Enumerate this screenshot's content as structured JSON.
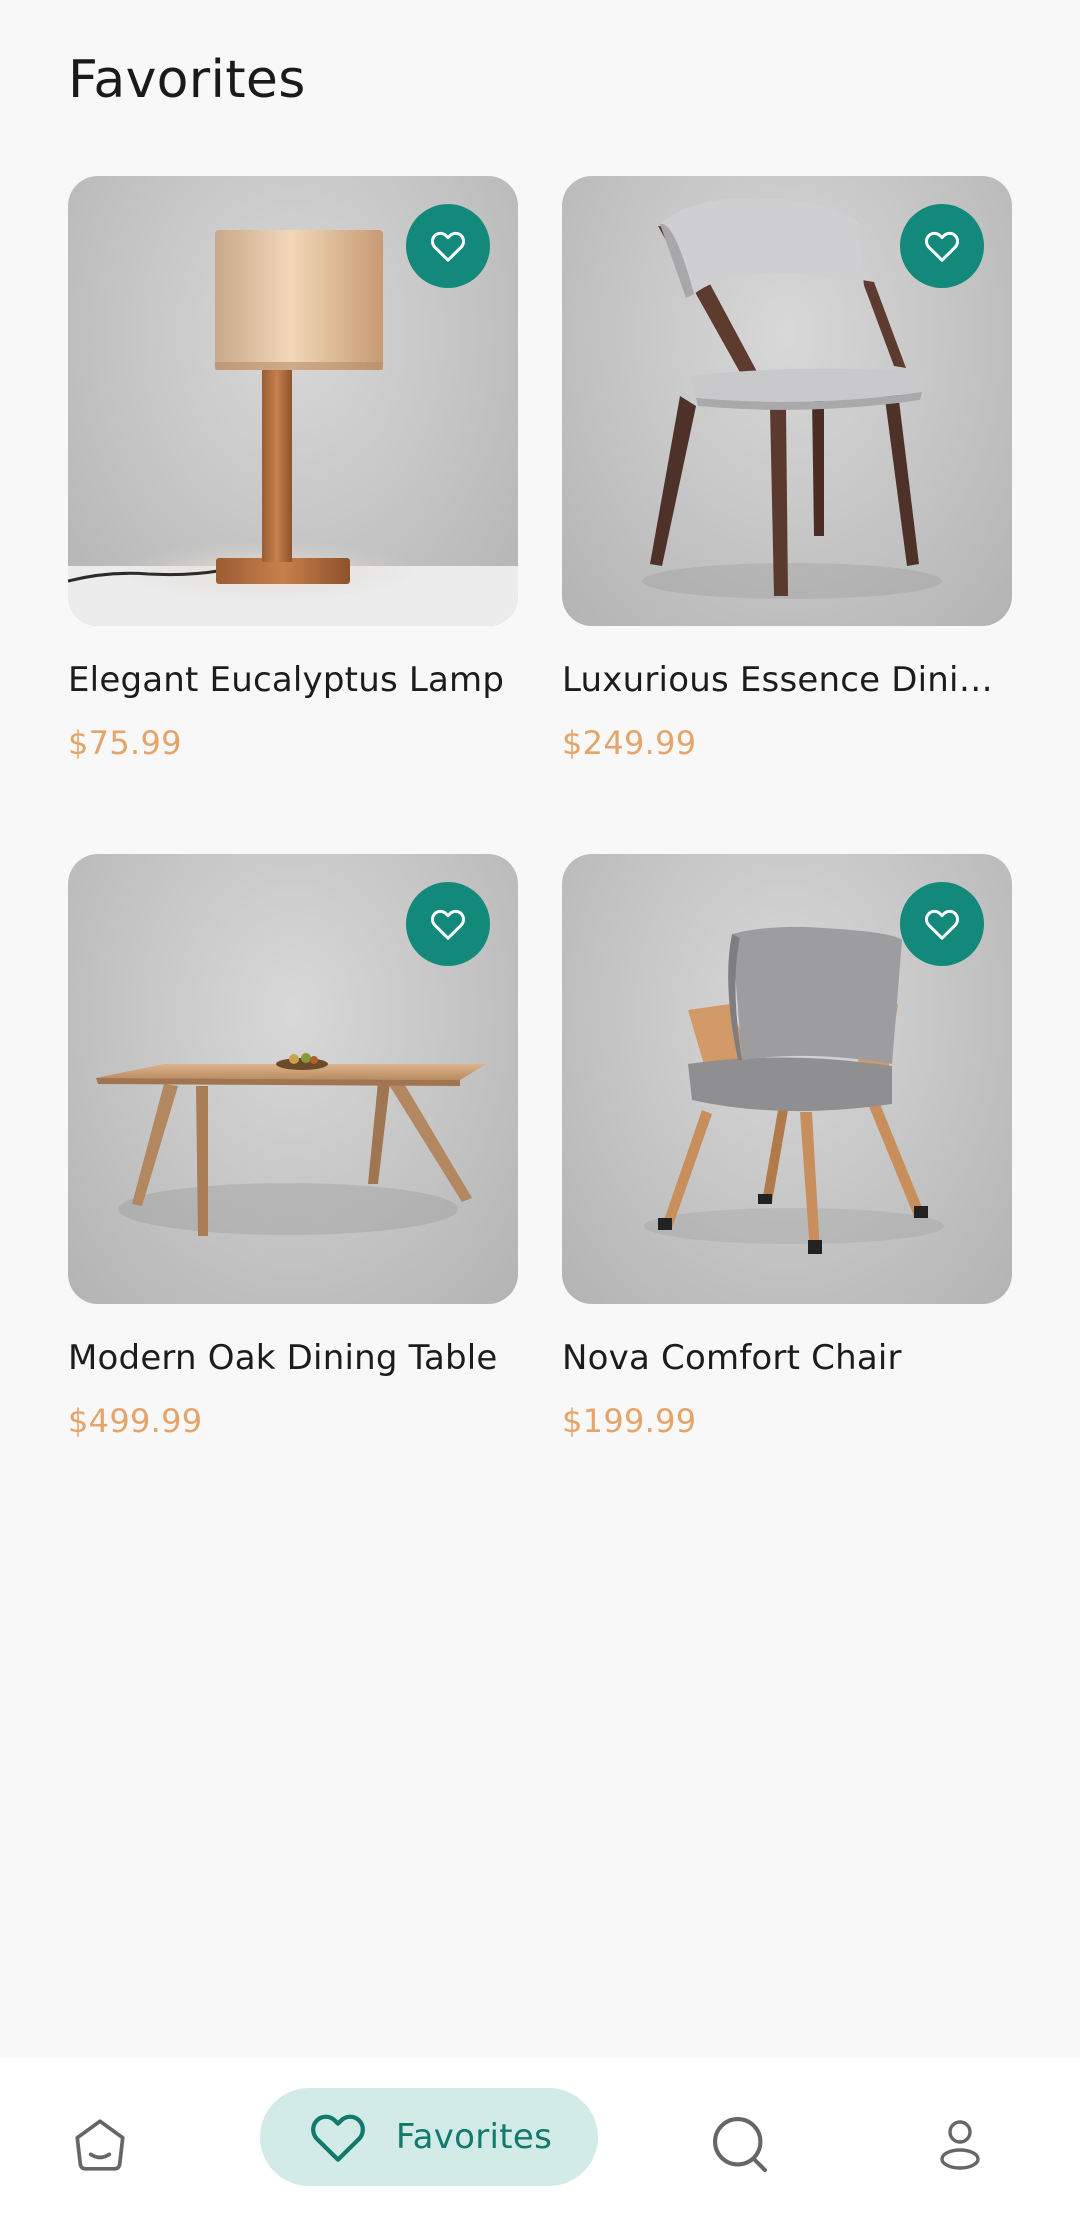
{
  "header": {
    "title": "Favorites"
  },
  "favorites": [
    {
      "name": "Elegant Eucalyptus Lamp",
      "price": "$75.99",
      "image": "lamp"
    },
    {
      "name": "Luxurious Essence Dinin…",
      "price": "$249.99",
      "image": "dining-chair"
    },
    {
      "name": "Modern Oak Dining Table",
      "price": "$499.99",
      "image": "dining-table"
    },
    {
      "name": "Nova Comfort Chair",
      "price": "$199.99",
      "image": "armchair"
    }
  ],
  "bottom_nav": {
    "items": [
      {
        "icon": "home-icon"
      },
      {
        "icon": "heart-icon",
        "label": "Favorites",
        "active": true
      },
      {
        "icon": "search-icon"
      },
      {
        "icon": "profile-icon"
      }
    ]
  },
  "colors": {
    "accent": "#12897a",
    "price": "#e5a46a",
    "active_nav_bg": "#d3ebe7",
    "background": "#f8f8f8"
  }
}
